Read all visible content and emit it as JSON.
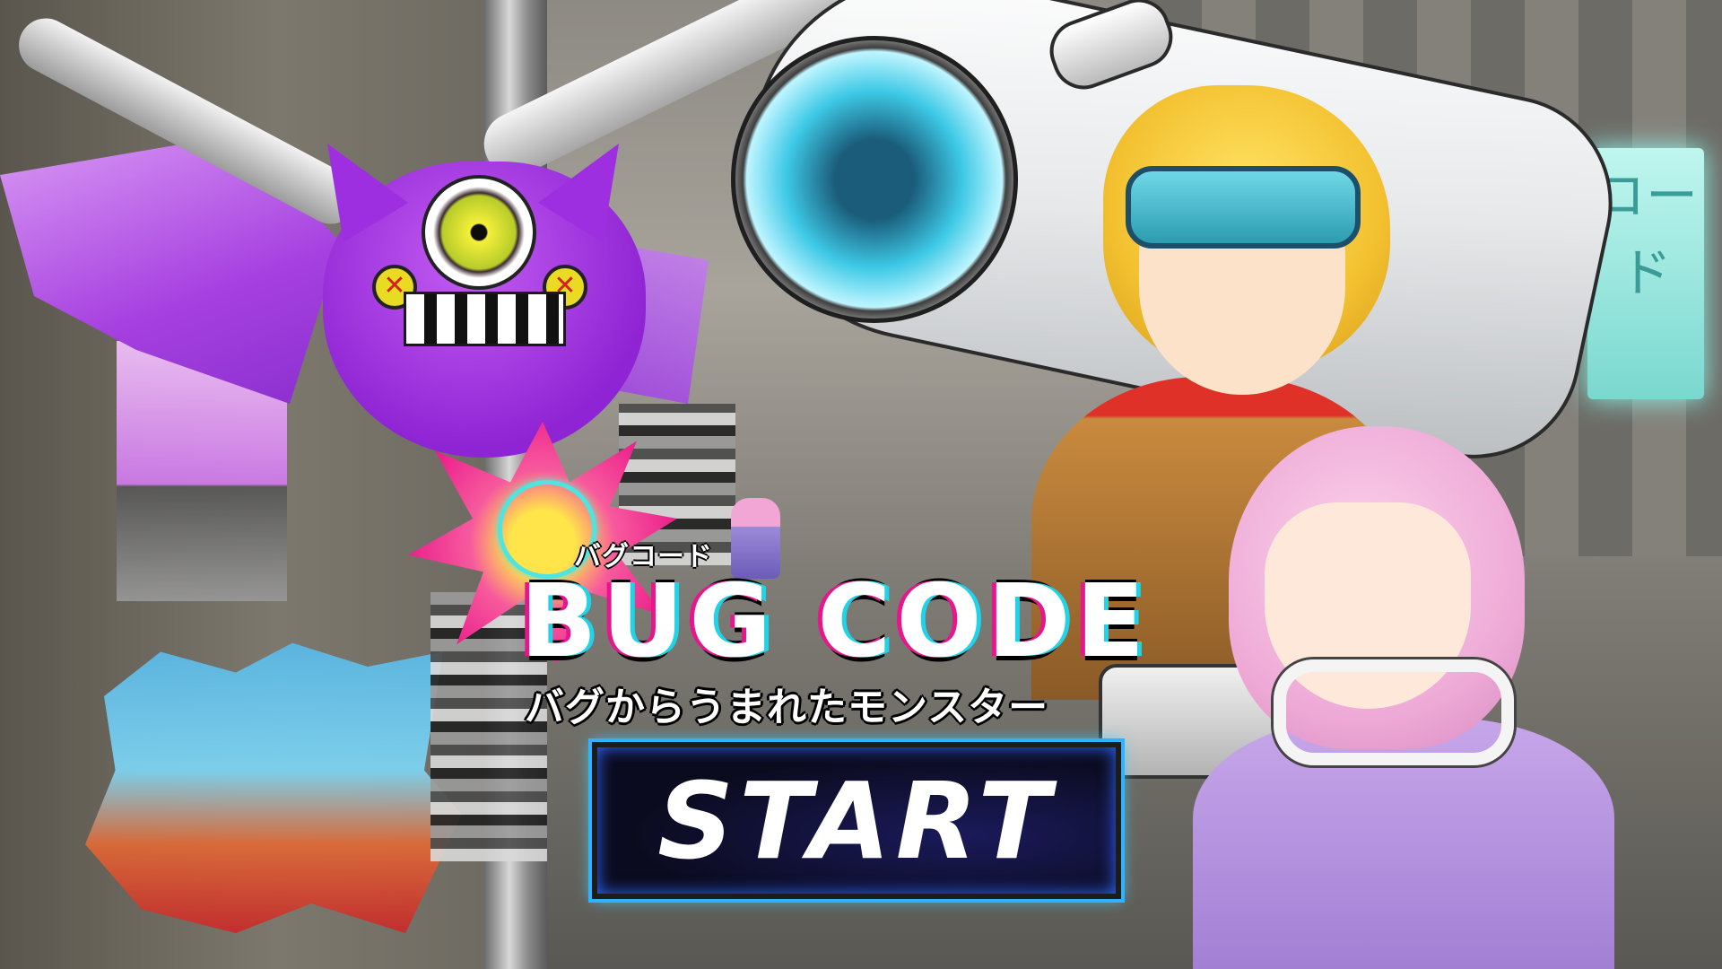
{
  "game": {
    "logo": {
      "kana": "バグコード",
      "title": "BUG CODE",
      "subtitle": "バグからうまれたモンスター"
    },
    "start_button": {
      "label": "START"
    },
    "background": {
      "neon_sign_text": "コード"
    },
    "colors": {
      "accent_pink": "#e6168d",
      "accent_cyan": "#1fd3e8",
      "button_glow": "#2fb3ff",
      "monster_purple": "#9d2fe0"
    },
    "icons": [
      "reticle-icon",
      "x-eye-icon"
    ]
  }
}
